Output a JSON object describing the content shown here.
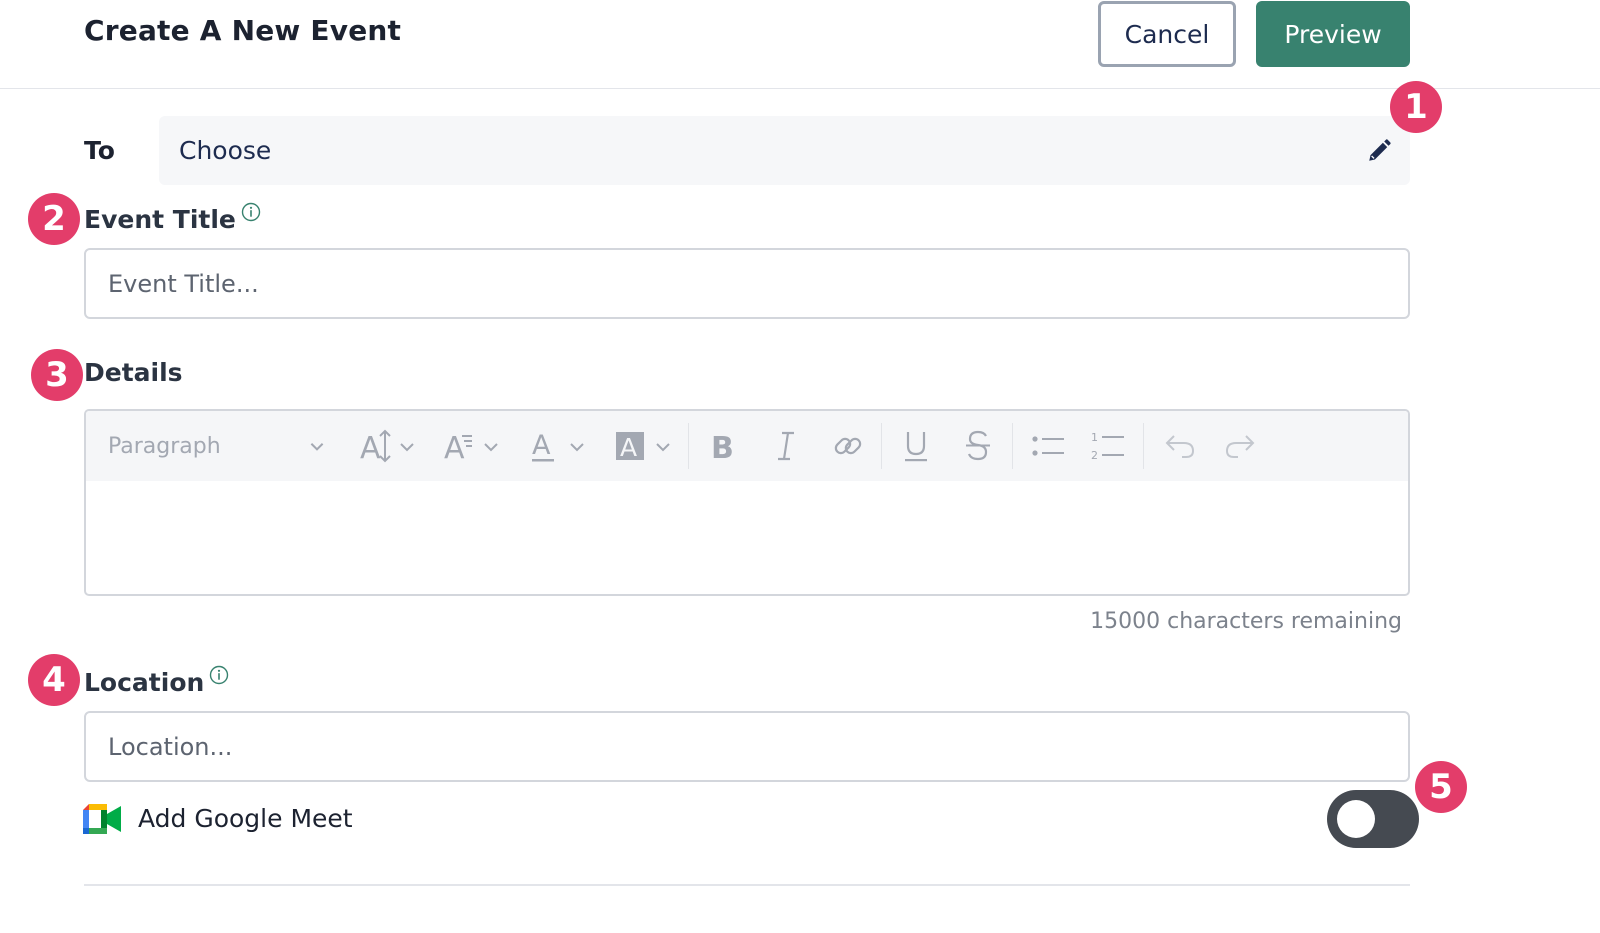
{
  "header": {
    "title": "Create A New Event",
    "cancel_label": "Cancel",
    "preview_label": "Preview"
  },
  "recipient": {
    "label": "To",
    "value": "Choose",
    "edit_icon": "pencil-icon"
  },
  "event_title": {
    "label": "Event Title",
    "placeholder": "Event Title...",
    "value": "",
    "info_icon": "info-icon"
  },
  "details": {
    "label": "Details",
    "paragraph_style": "Paragraph",
    "toolbar_icons": [
      "font-size-icon",
      "font-family-icon",
      "font-color-icon",
      "highlight-color-icon",
      "bold-icon",
      "italic-icon",
      "link-icon",
      "underline-icon",
      "strikethrough-icon",
      "bulleted-list-icon",
      "numbered-list-icon",
      "undo-icon",
      "redo-icon"
    ],
    "chars_remaining": "15000 characters remaining"
  },
  "location": {
    "label": "Location",
    "placeholder": "Location...",
    "value": "",
    "info_icon": "info-icon"
  },
  "google_meet": {
    "label": "Add Google Meet",
    "enabled": false
  },
  "badges": [
    "1",
    "2",
    "3",
    "4",
    "5"
  ],
  "colors": {
    "accent": "#38826f",
    "badge": "#e33d6a",
    "toggle_off": "#454a51",
    "link_text": "#1d2b4f"
  }
}
